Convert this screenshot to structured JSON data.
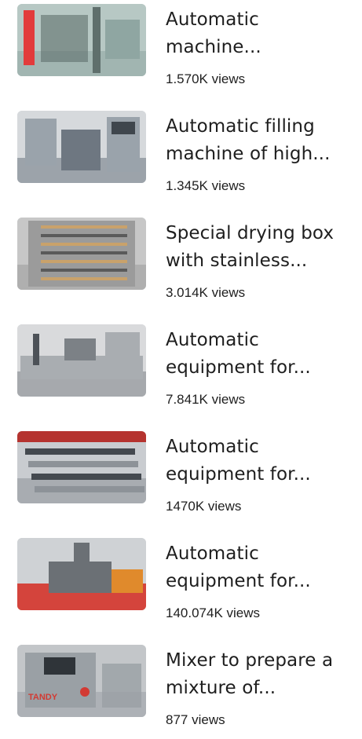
{
  "videos": [
    {
      "title": "Automatic machine...",
      "views": "1.570K views",
      "thumbnail_icon": "packaging-machine-thumbnail",
      "palette": {
        "bg": "#b7c8c4",
        "a": "#e23b3b",
        "b": "#8fa6a2",
        "c": "#5f6f6c"
      }
    },
    {
      "title": "Automatic filling machine of high...",
      "views": "1.345K views",
      "thumbnail_icon": "filling-machine-thumbnail",
      "palette": {
        "bg": "#d6d9dc",
        "a": "#9aa3ab",
        "b": "#6e7781",
        "c": "#3f464d"
      }
    },
    {
      "title": "Special drying box with stainless...",
      "views": "3.014K views",
      "thumbnail_icon": "drying-box-thumbnail",
      "palette": {
        "bg": "#c7c7c7",
        "a": "#c9a26b",
        "b": "#9b9b9b",
        "c": "#5a5a5a"
      }
    },
    {
      "title": "Automatic equipment for...",
      "views": "7.841K views",
      "thumbnail_icon": "automatic-equipment-thumbnail",
      "palette": {
        "bg": "#d9dadc",
        "a": "#a9adb1",
        "b": "#7c8186",
        "c": "#4d5258"
      }
    },
    {
      "title": "Automatic equipment for...",
      "views": "1470K views",
      "thumbnail_icon": "conveyor-equipment-thumbnail",
      "palette": {
        "bg": "#c9ccd0",
        "a": "#b5332f",
        "b": "#8d9298",
        "c": "#44494f"
      }
    },
    {
      "title": "Automatic equipment for...",
      "views": "140.074K views",
      "thumbnail_icon": "rotary-equipment-thumbnail",
      "palette": {
        "bg": "#cfd2d5",
        "a": "#d4443c",
        "b": "#e08a2c",
        "c": "#6b7075"
      }
    },
    {
      "title": "Mixer to prepare a mixture of...",
      "views": "877 views",
      "thumbnail_icon": "mixer-machine-thumbnail",
      "thumbnail_logo": "TANDY",
      "palette": {
        "bg": "#c3c6c9",
        "a": "#d23a33",
        "b": "#9aa0a5",
        "c": "#2f3439"
      }
    }
  ]
}
